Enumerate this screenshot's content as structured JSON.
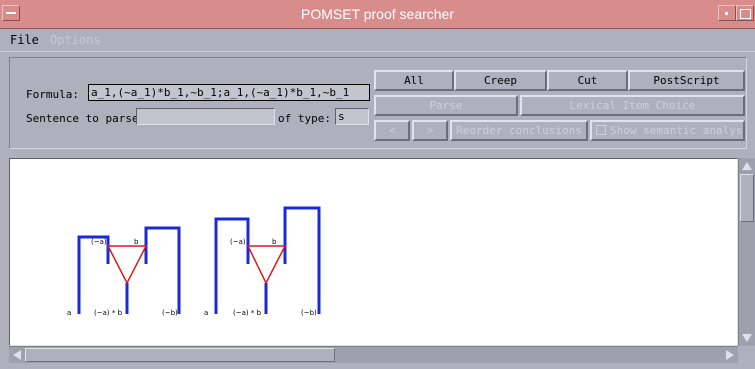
{
  "window": {
    "title": "POMSET proof searcher",
    "colors": {
      "titlebar": "#d98c8c",
      "background": "#b0b0bd",
      "canvas": "#ffffff"
    }
  },
  "menubar": {
    "file": "File",
    "options": "Options"
  },
  "form": {
    "formula_label": "Formula:",
    "formula_value": "a_1,(~a_1)*b_1,~b_1;a_1,(~a_1)*b_1,~b_1",
    "sentence_label": "Sentence to parse:",
    "sentence_value": "",
    "type_label": "of type:",
    "type_value": "s"
  },
  "buttons": {
    "all": "All",
    "creep": "Creep",
    "cut": "Cut",
    "postscript": "PostScript",
    "parse": "Parse",
    "lexical_item_choice": "Lexical Item Choice",
    "prev": "<",
    "next": ">",
    "reorder_conclusions": "Reorder conclusions",
    "show_semantic_analysis": "Show semantic analysis"
  },
  "diagram": {
    "proofs": [
      {
        "labels": {
          "a": "a",
          "neg_a": "(~a)",
          "b": "b",
          "neg_a_times_b": "(~a) * b",
          "neg_b": "(~b)"
        }
      },
      {
        "labels": {
          "a": "a",
          "neg_a": "(~a)",
          "b": "b",
          "neg_a_times_b": "(~a) * b",
          "neg_b": "(~b)"
        }
      }
    ],
    "colors": {
      "axiom_links": "#1a2bd6",
      "par_link": "#e01818"
    }
  }
}
